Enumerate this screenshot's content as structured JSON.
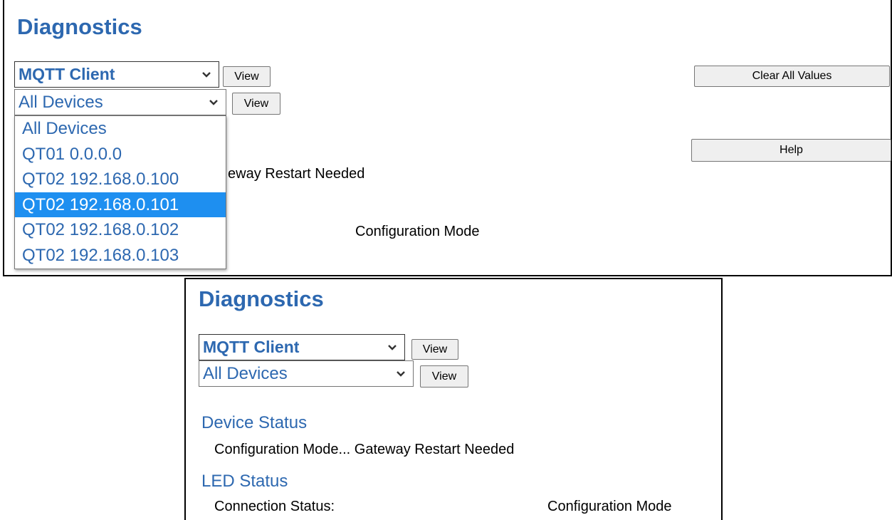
{
  "top": {
    "title": "Diagnostics",
    "module_select": {
      "value": "MQTT Client"
    },
    "device_select": {
      "value": "All Devices"
    },
    "view_label": "View",
    "clear_label": "Clear All Values",
    "help_label": "Help",
    "device_options": [
      "All Devices",
      "QT01 0.0.0.0",
      "QT02 192.168.0.100",
      "QT02 192.168.0.101",
      "QT02 192.168.0.102",
      "QT02 192.168.0.103"
    ],
    "selected_option": "QT02 192.168.0.101",
    "peek_restart": "eway Restart Needed",
    "peek_config_mode": "Configuration Mode"
  },
  "bottom": {
    "title": "Diagnostics",
    "module_select": {
      "value": "MQTT Client"
    },
    "device_select": {
      "value": "All Devices"
    },
    "view_label": "View",
    "device_status": {
      "heading": "Device Status",
      "line": "Configuration Mode... Gateway Restart Needed"
    },
    "led_status": {
      "heading": "LED Status",
      "label": "Connection Status:",
      "value": "Configuration Mode"
    }
  },
  "colors": {
    "accent": "#2d68b0",
    "highlight": "#1e8ff0"
  }
}
